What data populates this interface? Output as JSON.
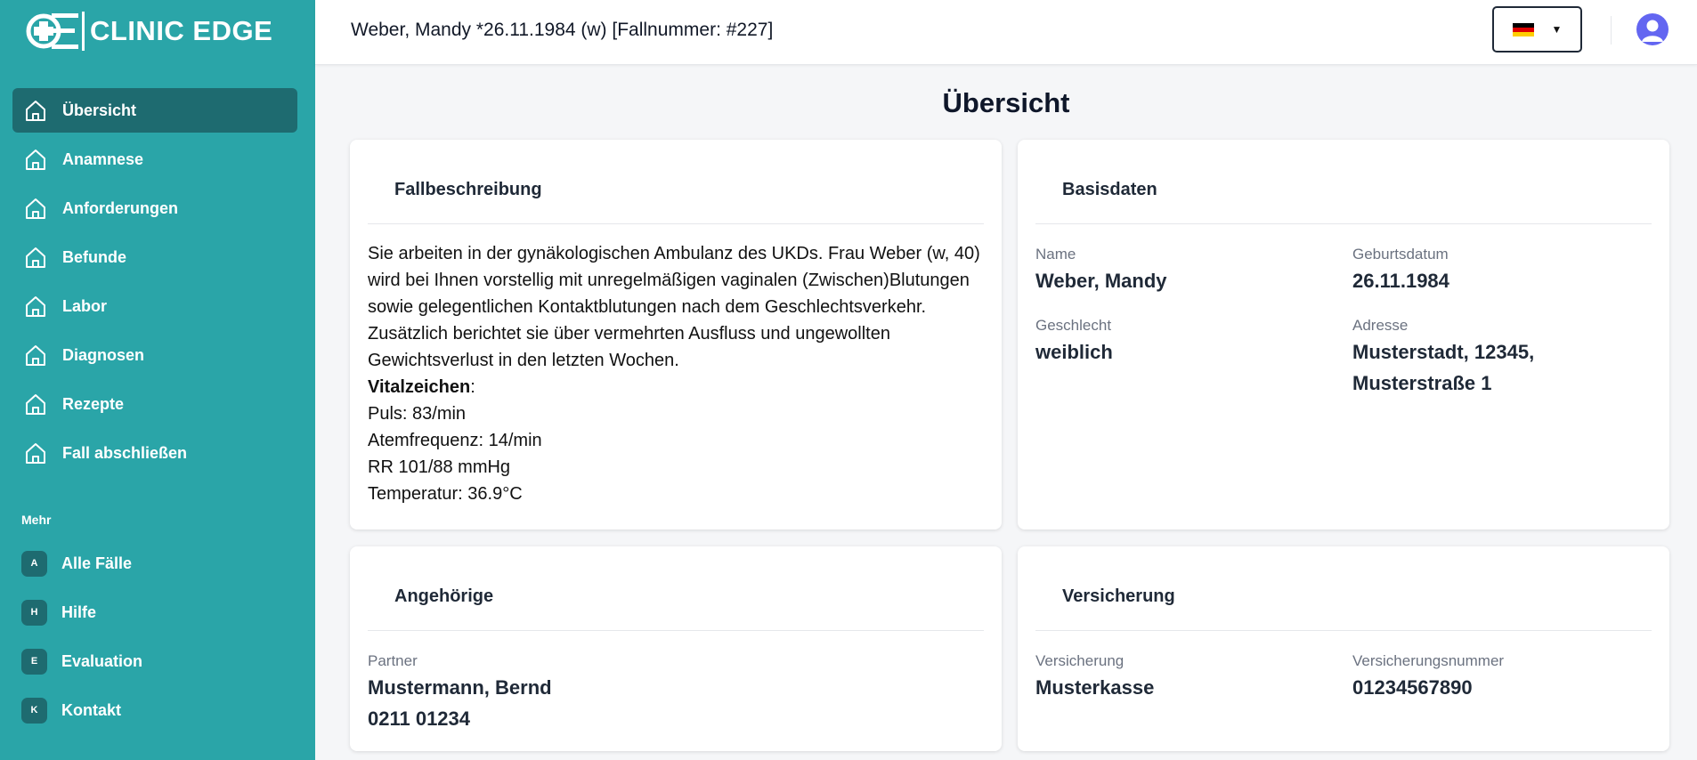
{
  "app": {
    "logo_text": "CLINIC EDGE"
  },
  "header": {
    "patient": "Weber, Mandy *26.11.1984 (w) [Fallnummer: #227]",
    "caret": "▼"
  },
  "sidebar": {
    "items": [
      {
        "label": "Übersicht",
        "active": true
      },
      {
        "label": "Anamnese"
      },
      {
        "label": "Anforderungen"
      },
      {
        "label": "Befunde"
      },
      {
        "label": "Labor"
      },
      {
        "label": "Diagnosen"
      },
      {
        "label": "Rezepte"
      },
      {
        "label": "Fall abschließen"
      }
    ],
    "more_label": "Mehr",
    "more_items": [
      {
        "badge": "A",
        "label": "Alle Fälle"
      },
      {
        "badge": "H",
        "label": "Hilfe"
      },
      {
        "badge": "E",
        "label": "Evaluation"
      },
      {
        "badge": "K",
        "label": "Kontakt"
      }
    ]
  },
  "page": {
    "title": "Übersicht"
  },
  "fallbeschreibung": {
    "title": "Fallbeschreibung",
    "text": "Sie arbeiten in der gynäkologischen Ambulanz des UKDs. Frau Weber (w, 40) wird bei Ihnen vorstellig mit unregelmäßigen vaginalen (Zwischen)Blutungen sowie gelegentlichen Kontaktblutungen nach dem Geschlechtsverkehr. Zusätzlich berichtet sie über vermehrten Ausfluss und ungewollten Gewichtsverlust in den letzten Wochen.",
    "vitals_heading": "Vitalzeichen",
    "vitals_colon": ":",
    "vitals": [
      "Puls: 83/min",
      "Atemfrequenz: 14/min",
      "RR 101/88 mmHg",
      "Temperatur: 36.9°C"
    ]
  },
  "basisdaten": {
    "title": "Basisdaten",
    "name_label": "Name",
    "name": "Weber, Mandy",
    "birth_label": "Geburtsdatum",
    "birth": "26.11.1984",
    "sex_label": "Geschlecht",
    "sex": "weiblich",
    "address_label": "Adresse",
    "address_line1": "Musterstadt, 12345,",
    "address_line2": "Musterstraße 1"
  },
  "angehoerige": {
    "title": "Angehörige",
    "relation_label": "Partner",
    "name": "Mustermann, Bernd",
    "phone": "0211 01234"
  },
  "versicherung": {
    "title": "Versicherung",
    "insurer_label": "Versicherung",
    "insurer": "Musterkasse",
    "number_label": "Versicherungsnummer",
    "number": "01234567890"
  },
  "colors": {
    "sidebar": "#2aa5a8",
    "active": "#1e6b70",
    "avatar": "#6366f1"
  },
  "icons": {
    "nav": "home-icon",
    "user": "user-icon",
    "lang": "germany-flag-icon"
  }
}
